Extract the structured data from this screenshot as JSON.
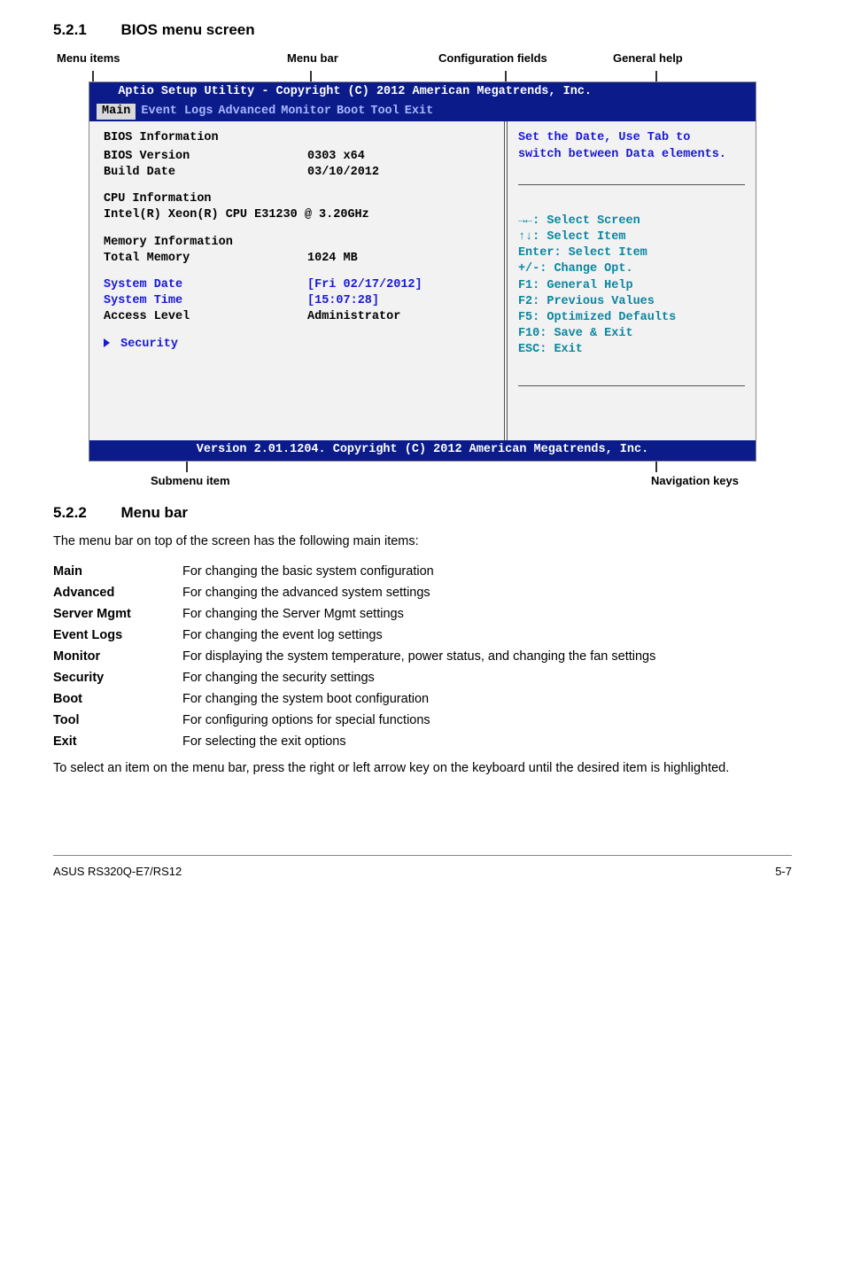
{
  "sections": {
    "s1": {
      "num": "5.2.1",
      "title": "BIOS menu screen"
    },
    "s2": {
      "num": "5.2.2",
      "title": "Menu bar"
    }
  },
  "annotations": {
    "menu_items": "Menu items",
    "menu_bar": "Menu bar",
    "config_fields": "Configuration fields",
    "general_help": "General help",
    "submenu_item": "Submenu item",
    "nav_keys": "Navigation keys"
  },
  "bios": {
    "title_bar": "Aptio Setup Utility - Copyright (C) 2012 American Megatrends, Inc.",
    "tabs": [
      "Main",
      "Event Logs",
      "Advanced",
      "Monitor",
      "Boot",
      "Tool",
      "Exit"
    ],
    "selected_tab": "Main",
    "left": {
      "bios_info_header": "BIOS Information",
      "bios_version_k": "BIOS Version",
      "bios_version_v": "0303 x64",
      "build_date_k": "Build Date",
      "build_date_v": "03/10/2012",
      "cpu_info_header": "CPU Information",
      "cpu_line": "Intel(R) Xeon(R) CPU E31230 @ 3.20GHz",
      "mem_header": "Memory Information",
      "total_mem_k": "Total Memory",
      "total_mem_v": "1024 MB",
      "sys_date_k": "System Date",
      "sys_date_v": "[Fri 02/17/2012]",
      "sys_time_k": "System Time",
      "sys_time_v": "[15:07:28]",
      "access_k": "Access Level",
      "access_v": "Administrator",
      "security": "Security"
    },
    "help": {
      "line1": "Set the Date, Use Tab to",
      "line2": "switch between Data elements.",
      "nav": [
        "→←: Select Screen",
        "↑↓:  Select Item",
        "Enter: Select Item",
        "+/-: Change Opt.",
        "F1: General Help",
        "F2: Previous Values",
        "F5: Optimized Defaults",
        "F10: Save & Exit",
        "ESC: Exit"
      ]
    },
    "bottom": "Version 2.01.1204. Copyright (C) 2012 American Megatrends, Inc."
  },
  "menubar_intro": "The menu bar on top of the screen has the following main items:",
  "menubar_items": [
    {
      "term": "Main",
      "desc": "For changing the basic system configuration"
    },
    {
      "term": "Advanced",
      "desc": "For changing the advanced system settings"
    },
    {
      "term": "Server Mgmt",
      "desc": "For changing the Server Mgmt settings"
    },
    {
      "term": "Event Logs",
      "desc": "For changing the event log settings"
    },
    {
      "term": "Monitor",
      "desc": "For displaying the system temperature, power status, and changing the fan settings"
    },
    {
      "term": "Security",
      "desc": "For changing the security settings"
    },
    {
      "term": "Boot",
      "desc": "For changing the system boot configuration"
    },
    {
      "term": "Tool",
      "desc": "For configuring options for special functions"
    },
    {
      "term": "Exit",
      "desc": "For selecting the exit options"
    }
  ],
  "menubar_closing": "To select an item on the menu bar, press the right or left arrow key on the keyboard until the desired item is highlighted.",
  "footer": {
    "left": "ASUS RS320Q-E7/RS12",
    "right": "5-7"
  }
}
